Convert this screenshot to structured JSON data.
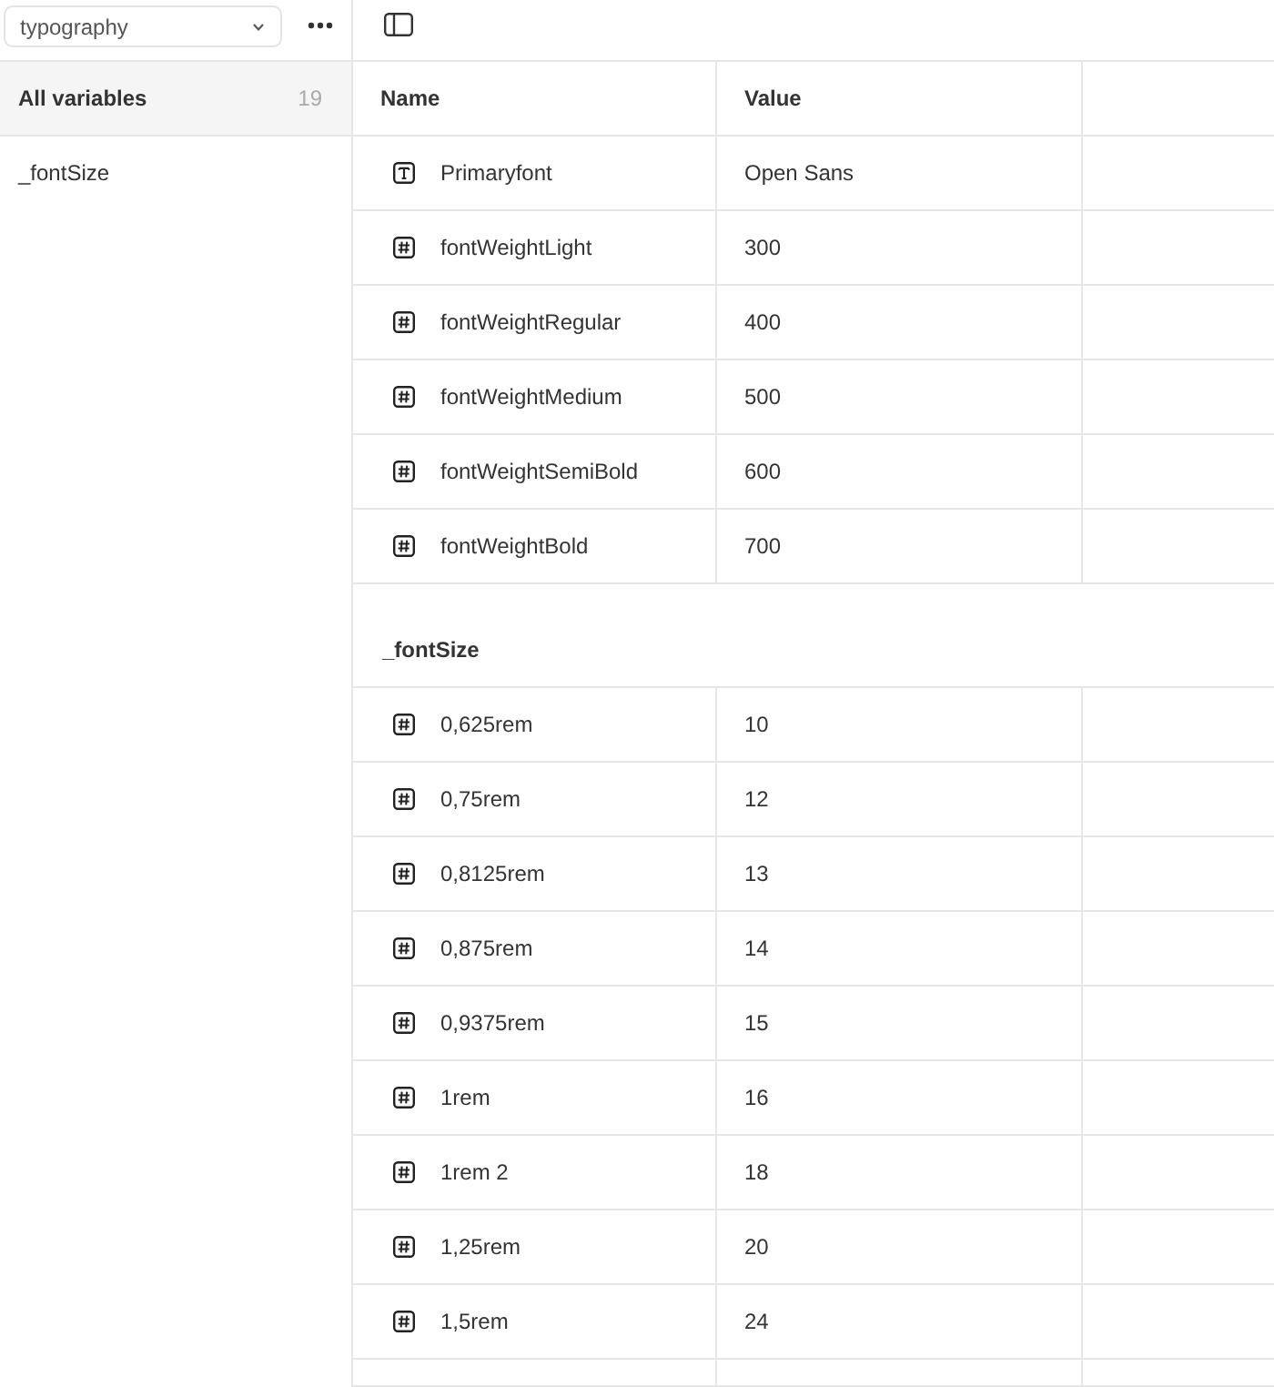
{
  "toolbar": {
    "collection": "typography"
  },
  "sidebar": {
    "items": [
      {
        "label": "All variables",
        "count": "19",
        "selected": true
      },
      {
        "label": "_fontSize",
        "selected": false
      }
    ]
  },
  "table": {
    "columns": [
      "Name",
      "Value"
    ],
    "groups": [
      {
        "rows": [
          {
            "kind": "string",
            "name": "Primaryfont",
            "value": "Open Sans"
          },
          {
            "kind": "number",
            "name": "fontWeightLight",
            "value": "300"
          },
          {
            "kind": "number",
            "name": "fontWeightRegular",
            "value": "400"
          },
          {
            "kind": "number",
            "name": "fontWeightMedium",
            "value": "500"
          },
          {
            "kind": "number",
            "name": "fontWeightSemiBold",
            "value": "600"
          },
          {
            "kind": "number",
            "name": "fontWeightBold",
            "value": "700"
          }
        ]
      },
      {
        "title": "_fontSize",
        "rows": [
          {
            "kind": "number",
            "name": "0,625rem",
            "value": "10"
          },
          {
            "kind": "number",
            "name": "0,75rem",
            "value": "12"
          },
          {
            "kind": "number",
            "name": "0,8125rem",
            "value": "13"
          },
          {
            "kind": "number",
            "name": "0,875rem",
            "value": "14"
          },
          {
            "kind": "number",
            "name": "0,9375rem",
            "value": "15"
          },
          {
            "kind": "number",
            "name": "1rem",
            "value": "16"
          },
          {
            "kind": "number",
            "name": "1rem 2",
            "value": "18"
          },
          {
            "kind": "number",
            "name": "1,25rem",
            "value": "20"
          },
          {
            "kind": "number",
            "name": "1,5rem",
            "value": "24"
          }
        ]
      }
    ]
  }
}
